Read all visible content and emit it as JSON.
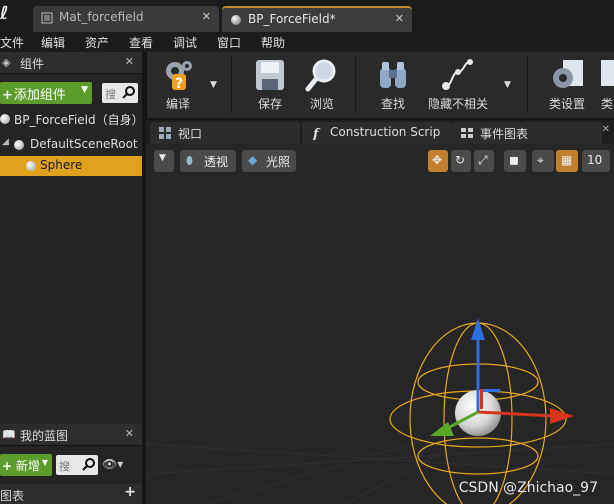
{
  "tabs": [
    {
      "label": "Mat_forcefield",
      "close": "✕"
    },
    {
      "label": "BP_ForceField*",
      "close": "✕"
    }
  ],
  "menu": [
    "文件",
    "编辑",
    "资产",
    "查看",
    "调试",
    "窗口",
    "帮助"
  ],
  "components_panel": {
    "title": "组件",
    "add_button": "添加组件",
    "search_placeholder": "搜",
    "root_label": "BP_ForceField（自身）",
    "tree": [
      "DefaultSceneRoot",
      "Sphere"
    ]
  },
  "my_blueprint_panel": {
    "title": "我的蓝图",
    "add_button": "新增",
    "search_placeholder": "搜",
    "section_label": "图表"
  },
  "toolbar": {
    "compile": "编译",
    "save": "保存",
    "browse": "浏览",
    "find": "查找",
    "hide_unrelated": "隐藏不相关",
    "class_settings": "类设置",
    "class_defaults_partial": "类"
  },
  "graph_tabs": [
    {
      "label": "视口",
      "icon": "viewport-icon"
    },
    {
      "label": "Construction Scrip",
      "icon": "function-icon"
    },
    {
      "label": "事件图表",
      "icon": "event-graph-icon"
    }
  ],
  "viewport": {
    "perspective": "透视",
    "lit": "光照",
    "grid_size": "10"
  },
  "watermark": "CSDN @Zhichao_97",
  "colors": {
    "accent_orange": "#e0a21c",
    "add_green": "#5c9c2c",
    "gizmo_blue": "#2d6fe0",
    "gizmo_red": "#d6341c",
    "gizmo_green": "#5aa82a",
    "wire_yellow": "#e8a81c"
  }
}
